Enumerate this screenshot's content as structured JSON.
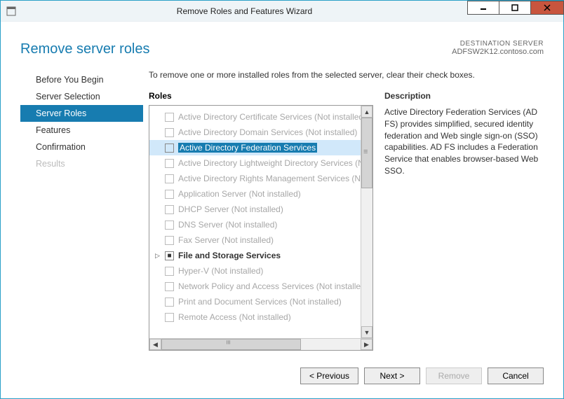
{
  "window": {
    "title": "Remove Roles and Features Wizard"
  },
  "header": {
    "page_title": "Remove server roles",
    "dest_label": "DESTINATION SERVER",
    "dest_server": "ADFSW2K12.contoso.com"
  },
  "sidebar": {
    "items": [
      {
        "label": "Before You Begin",
        "state": "normal"
      },
      {
        "label": "Server Selection",
        "state": "normal"
      },
      {
        "label": "Server Roles",
        "state": "active"
      },
      {
        "label": "Features",
        "state": "normal"
      },
      {
        "label": "Confirmation",
        "state": "normal"
      },
      {
        "label": "Results",
        "state": "disabled"
      }
    ]
  },
  "main": {
    "instruction": "To remove one or more installed roles from the selected server, clear their check boxes.",
    "roles_heading": "Roles",
    "desc_heading": "Description",
    "roles": [
      {
        "label": "Active Directory Certificate Services (Not installed)",
        "enabled": false,
        "checked": false,
        "selected": false,
        "expandable": false
      },
      {
        "label": "Active Directory Domain Services (Not installed)",
        "enabled": false,
        "checked": false,
        "selected": false,
        "expandable": false
      },
      {
        "label": "Active Directory Federation Services",
        "enabled": true,
        "checked": false,
        "selected": true,
        "expandable": false
      },
      {
        "label": "Active Directory Lightweight Directory Services (Not installed)",
        "enabled": false,
        "checked": false,
        "selected": false,
        "expandable": false
      },
      {
        "label": "Active Directory Rights Management Services (Not installed)",
        "enabled": false,
        "checked": false,
        "selected": false,
        "expandable": false
      },
      {
        "label": "Application Server (Not installed)",
        "enabled": false,
        "checked": false,
        "selected": false,
        "expandable": false
      },
      {
        "label": "DHCP Server (Not installed)",
        "enabled": false,
        "checked": false,
        "selected": false,
        "expandable": false
      },
      {
        "label": "DNS Server (Not installed)",
        "enabled": false,
        "checked": false,
        "selected": false,
        "expandable": false
      },
      {
        "label": "Fax Server (Not installed)",
        "enabled": false,
        "checked": false,
        "selected": false,
        "expandable": false
      },
      {
        "label": "File and Storage Services",
        "enabled": true,
        "checked": "mixed",
        "selected": false,
        "expandable": true
      },
      {
        "label": "Hyper-V (Not installed)",
        "enabled": false,
        "checked": false,
        "selected": false,
        "expandable": false
      },
      {
        "label": "Network Policy and Access Services (Not installed)",
        "enabled": false,
        "checked": false,
        "selected": false,
        "expandable": false
      },
      {
        "label": "Print and Document Services (Not installed)",
        "enabled": false,
        "checked": false,
        "selected": false,
        "expandable": false
      },
      {
        "label": "Remote Access (Not installed)",
        "enabled": false,
        "checked": false,
        "selected": false,
        "expandable": false
      }
    ],
    "description": "Active Directory Federation Services (AD FS) provides simplified, secured identity federation and Web single sign-on (SSO) capabilities. AD FS includes a Federation Service that enables browser-based Web SSO."
  },
  "footer": {
    "previous": "< Previous",
    "next": "Next >",
    "remove": "Remove",
    "cancel": "Cancel"
  }
}
